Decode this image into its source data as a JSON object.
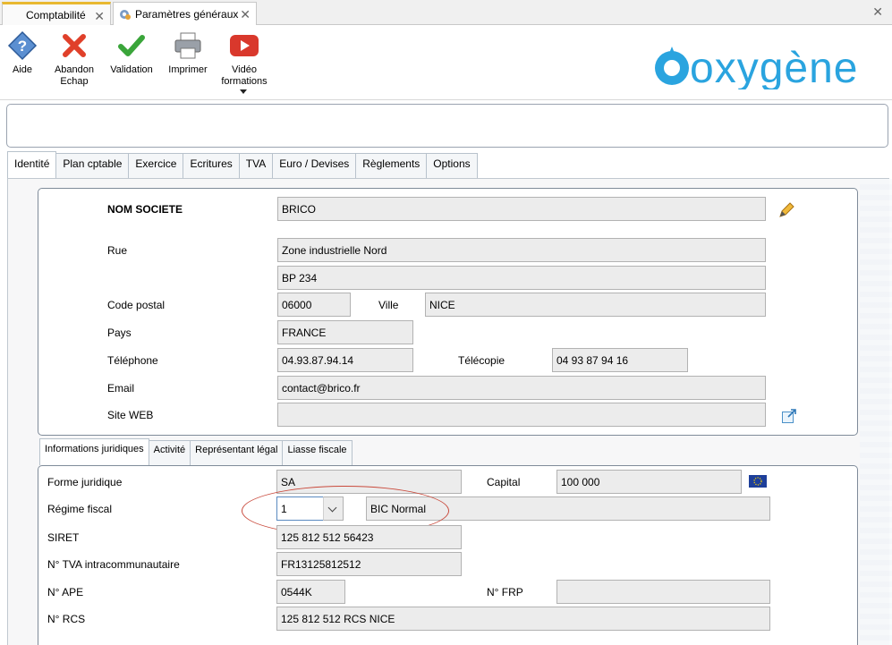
{
  "tabs": [
    {
      "label": "Comptabilité"
    },
    {
      "label": "Paramètres généraux"
    }
  ],
  "toolbar": {
    "aide": "Aide",
    "abandon_1": "Abandon",
    "abandon_2": "Echap",
    "validation": "Validation",
    "imprimer": "Imprimer",
    "video_1": "Vidéo",
    "video_2": "formations"
  },
  "brand": {
    "name": "oxygène",
    "color": "#2aa4df"
  },
  "main_tabs": [
    "Identité",
    "Plan cptable",
    "Exercice",
    "Ecritures",
    "TVA",
    "Euro / Devises",
    "Règlements",
    "Options"
  ],
  "identity": {
    "nom_label": "NOM SOCIETE",
    "nom": "BRICO",
    "rue_label": "Rue",
    "rue1": "Zone industrielle Nord",
    "rue2": "BP 234",
    "cp_label": "Code postal",
    "cp": "06000",
    "ville_label": "Ville",
    "ville": "NICE",
    "pays_label": "Pays",
    "pays": "FRANCE",
    "tel_label": "Téléphone",
    "tel": "04.93.87.94.14",
    "fax_label": "Télécopie",
    "fax": "04 93 87 94 16",
    "email_label": "Email",
    "email": "contact@brico.fr",
    "web_label": "Site WEB",
    "web": ""
  },
  "sub_tabs": [
    "Informations juridiques",
    "Activité",
    "Représentant légal",
    "Liasse fiscale"
  ],
  "juridique": {
    "forme_label": "Forme juridique",
    "forme": "SA",
    "capital_label": "Capital",
    "capital": "100 000",
    "regime_label": "Régime fiscal",
    "regime_code": "1",
    "regime_text": "BIC Normal",
    "siret_label": "SIRET",
    "siret": "125 812 512 56423",
    "tva_label": "N° TVA intracommunautaire",
    "tva": "FR13125812512",
    "ape_label": "N° APE",
    "ape": "0544K",
    "frp_label": "N° FRP",
    "frp": "",
    "rcs_label": "N° RCS",
    "rcs": "125 812 512  RCS NICE"
  }
}
